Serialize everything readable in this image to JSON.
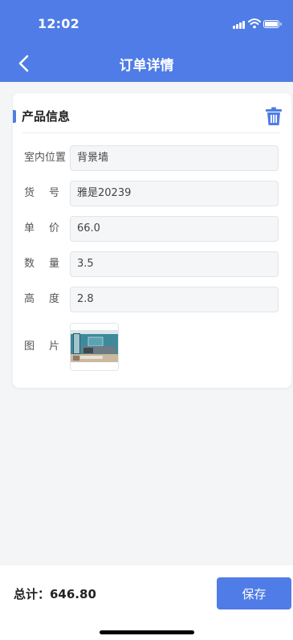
{
  "status_bar": {
    "time": "12:02"
  },
  "header": {
    "title": "订单详情"
  },
  "product": {
    "section_title": "产品信息",
    "fields": [
      {
        "label": "室内位置",
        "value": "背景墙"
      },
      {
        "label": "货号",
        "value": "雅是20239"
      },
      {
        "label": "单价",
        "value": "66.0"
      },
      {
        "label": "数量",
        "value": "3.5"
      },
      {
        "label": "高度",
        "value": "2.8"
      }
    ],
    "image_label": "图片"
  },
  "footer": {
    "total": "总计：646.80",
    "save_label": "保存"
  },
  "colors": {
    "accent": "#4f7ce6",
    "background": "#f4f5f7"
  }
}
